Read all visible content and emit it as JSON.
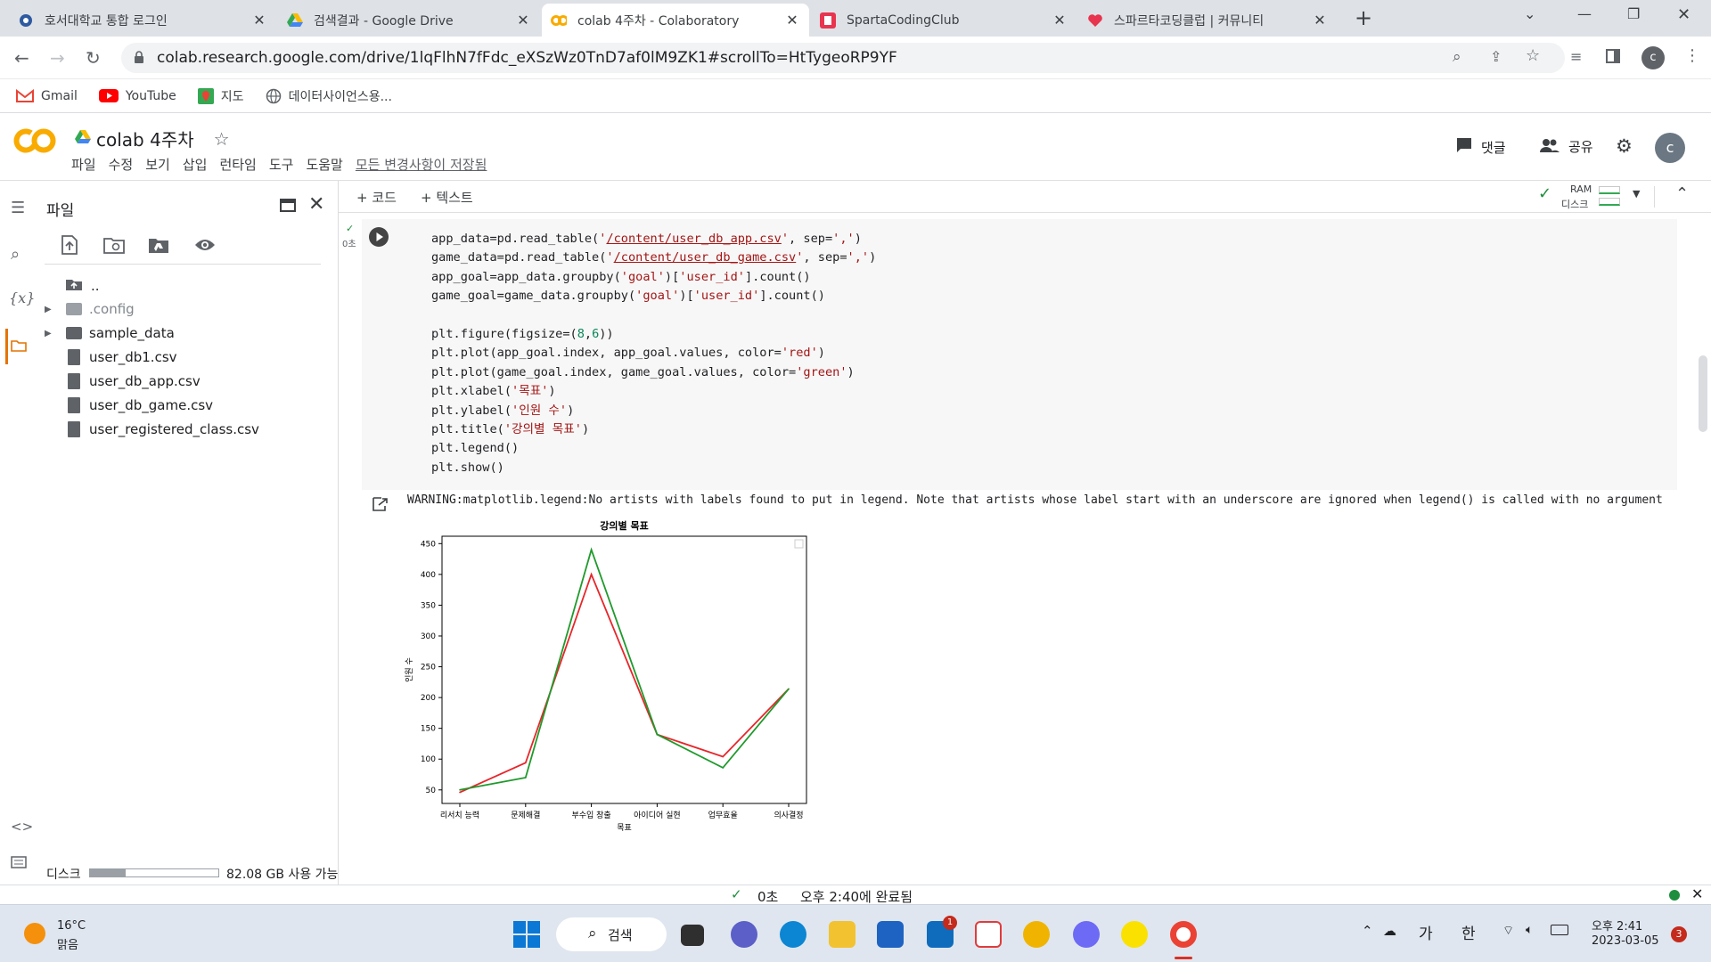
{
  "browser": {
    "tabs": [
      {
        "title": "호서대학교 통합 로그인",
        "icon": "university-favicon"
      },
      {
        "title": "검색결과 - Google Drive",
        "icon": "drive-favicon"
      },
      {
        "title": "colab 4주차 - Colaboratory",
        "icon": "colab-favicon",
        "active": true
      },
      {
        "title": "SpartaCodingClub",
        "icon": "sparta-favicon"
      },
      {
        "title": "스파르타코딩클럽 | 커뮤니티",
        "icon": "sparta-heart-favicon"
      }
    ],
    "url": "colab.research.google.com/drive/1lqFlhN7fFdc_eXSzWz0TnD7af0lM9ZK1#scrollTo=HtTygeoRP9YF",
    "profile_initial": "c",
    "bookmarks": [
      {
        "label": "Gmail",
        "icon": "gmail-icon"
      },
      {
        "label": "YouTube",
        "icon": "youtube-icon"
      },
      {
        "label": "지도",
        "icon": "maps-icon"
      },
      {
        "label": "데이터사이언스용...",
        "icon": "globe-icon"
      }
    ]
  },
  "colab": {
    "logo": "CO",
    "notebook_title": "colab 4주차",
    "menu": [
      "파일",
      "수정",
      "보기",
      "삽입",
      "런타임",
      "도구",
      "도움말"
    ],
    "save_status": "모든 변경사항이 저장됨",
    "comment_label": "댓글",
    "share_label": "공유",
    "user_initial": "c",
    "add_code": "+ 코드",
    "add_text": "+ 텍스트",
    "ram_label": "RAM",
    "disk_label": "디스크",
    "accent": "#f9ab00"
  },
  "sidebar": {
    "title": "파일",
    "tree": [
      {
        "name": "..",
        "kind": "up"
      },
      {
        "name": ".config",
        "kind": "folder",
        "muted": true
      },
      {
        "name": "sample_data",
        "kind": "folder"
      },
      {
        "name": "user_db1.csv",
        "kind": "file"
      },
      {
        "name": "user_db_app.csv",
        "kind": "file"
      },
      {
        "name": "user_db_game.csv",
        "kind": "file"
      },
      {
        "name": "user_registered_class.csv",
        "kind": "file"
      }
    ],
    "disk_label": "디스크",
    "disk_free": "82.08 GB 사용 가능",
    "disk_used_fraction": 0.28
  },
  "cell": {
    "exec_time": "0초",
    "warning": "WARNING:matplotlib.legend:No artists with labels found to put in legend.  Note that artists whose label start with an underscore are ignored when legend() is called with no argument"
  },
  "chart_data": {
    "type": "line",
    "title": "강의별 목표",
    "xlabel": "목표",
    "ylabel": "인원 수",
    "categories": [
      "리서치 능력",
      "문제해결",
      "부수입 창출",
      "아이디어 실현",
      "업무효율",
      "의사결정"
    ],
    "series": [
      {
        "color": "#e6262a",
        "values": [
          46,
          94,
          400,
          140,
          104,
          214
        ]
      },
      {
        "color": "#1f9a2c",
        "values": [
          50,
          70,
          440,
          140,
          86,
          214
        ]
      }
    ],
    "yticks": [
      50,
      100,
      150,
      200,
      250,
      300,
      350,
      400,
      450
    ],
    "ylim": [
      28,
      462
    ],
    "legend": "top-right (empty)",
    "grid": false
  },
  "status": {
    "exec": "0초",
    "completed": "오후 2:40에 완료됨"
  },
  "taskbar": {
    "temperature": "16°C",
    "weather": "맑음",
    "search_label": "검색",
    "mail_badge": "1",
    "ime_a": "가",
    "ime_b": "한",
    "time": "오후 2:41",
    "date": "2023-03-05",
    "notif_count": "3"
  }
}
